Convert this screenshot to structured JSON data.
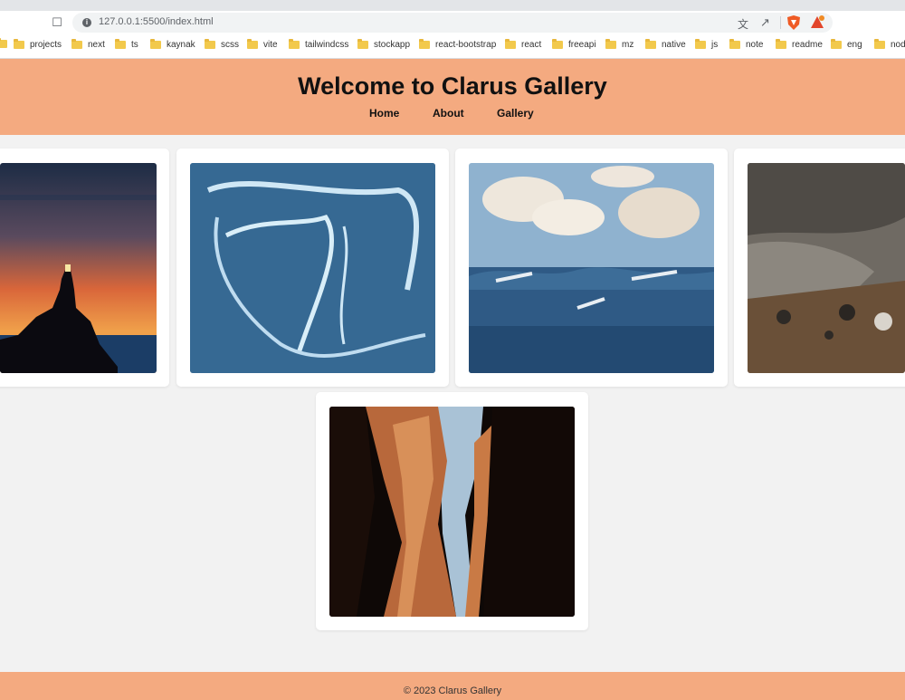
{
  "browser": {
    "url": "127.0.0.1:5500/index.html",
    "bookmarks": [
      "projects",
      "next",
      "ts",
      "kaynak",
      "scss",
      "vite",
      "tailwindcss",
      "stockapp",
      "react-bootstrap",
      "react",
      "freeapi",
      "mz",
      "native",
      "js",
      "note",
      "readme",
      "eng",
      "nod"
    ]
  },
  "header": {
    "title": "Welcome to Clarus Gallery",
    "nav": [
      "Home",
      "About",
      "Gallery"
    ]
  },
  "gallery": {
    "images": [
      {
        "subject": "lighthouse-sunset"
      },
      {
        "subject": "aerial-ice-water"
      },
      {
        "subject": "sea-waves-painting"
      },
      {
        "subject": "rocky-ground"
      },
      {
        "subject": "canyon"
      }
    ]
  },
  "footer": {
    "text": "© 2023 Clarus Gallery"
  },
  "colors": {
    "accent": "#f4aa80",
    "background": "#f2f2f2",
    "card": "#ffffff"
  }
}
